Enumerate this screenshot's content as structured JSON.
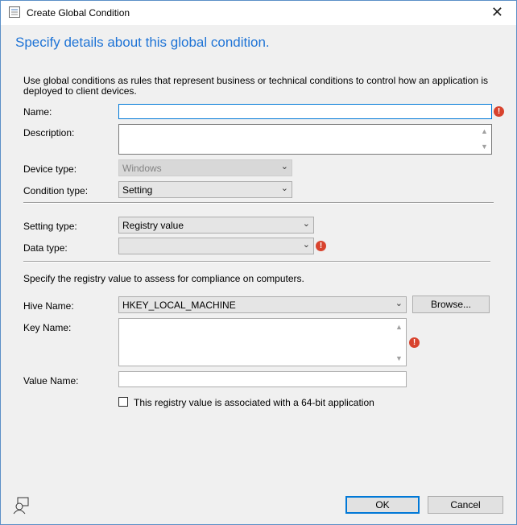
{
  "window": {
    "title": "Create Global Condition",
    "close": "✕"
  },
  "heading": "Specify details about this global condition.",
  "intro": "Use global conditions as rules that represent business or technical conditions to control how an application is deployed to client devices.",
  "fields": {
    "name_label": "Name:",
    "name_value": "",
    "description_label": "Description:",
    "description_value": "",
    "device_type_label": "Device type:",
    "device_type_value": "Windows",
    "condition_type_label": "Condition type:",
    "condition_type_value": "Setting",
    "setting_type_label": "Setting type:",
    "setting_type_value": "Registry value",
    "data_type_label": "Data type:",
    "data_type_value": ""
  },
  "registry": {
    "instructions": "Specify the registry value to assess for compliance on computers.",
    "hive_label": "Hive Name:",
    "hive_value": "HKEY_LOCAL_MACHINE",
    "browse": "Browse...",
    "key_label": "Key Name:",
    "key_value": "",
    "value_label": "Value Name:",
    "value_value": "",
    "checkbox_label": "This registry value is associated with a 64-bit application",
    "checkbox_checked": false
  },
  "buttons": {
    "ok": "OK",
    "cancel": "Cancel"
  },
  "error_glyph": "!",
  "colors": {
    "accent": "#1f74d6",
    "error": "#d8432e"
  }
}
